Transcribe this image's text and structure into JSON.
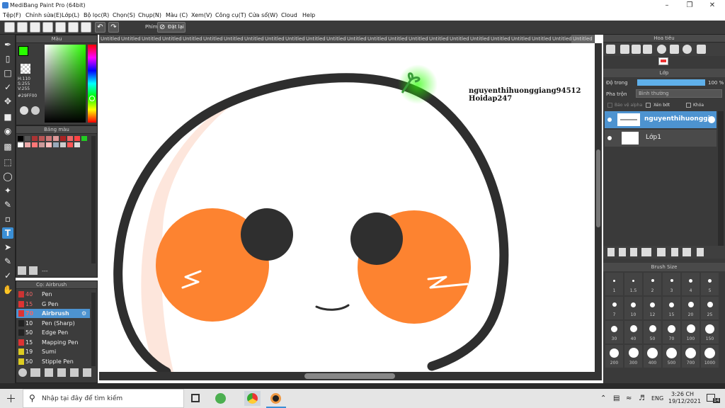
{
  "app": {
    "title": "MediBang Paint Pro (64bit)"
  },
  "menu": [
    "Tệp(F)",
    "Chỉnh sửa(E)",
    "Lớp(L)",
    "Bộ lọc(R)",
    "Chọn(S)",
    "Chụp(N)",
    "Màu (C)",
    "Xem(V)",
    "Công cụ(T)",
    "Cửa sổ(W)",
    "Cloud",
    "Help"
  ],
  "toolbar": {
    "phim_label": "Phím",
    "reset_label": "Đặt lại"
  },
  "color_panel": {
    "title": "Màu",
    "h": "H:110",
    "s": "S:255",
    "v": "V:255",
    "hex": "#29FF00",
    "fg": "#29ff00"
  },
  "palette_panel": {
    "title": "Bảng màu",
    "colors": [
      "#000000",
      "#555555",
      "#aa3333",
      "#bb5555",
      "#cc7777",
      "#dd9999",
      "#aa2222",
      "#ee6666",
      "#ff4444",
      "#22cc22",
      "#ffffff",
      "#eeaaaa",
      "#ff7777",
      "#cc9999",
      "#ffbbbb",
      "#99aabb",
      "#cccccc",
      "#ff5555",
      "#dddddd"
    ],
    "dash": "---"
  },
  "brush_panel": {
    "title": "Cọ: Airbrush",
    "items": [
      {
        "size": "40",
        "name": "Pen",
        "color": "#cc3333",
        "selected": false
      },
      {
        "size": "15",
        "name": "G Pen",
        "color": "#dd3333",
        "selected": false
      },
      {
        "size": "70",
        "name": "Airbrush",
        "color": "#dd3333",
        "selected": true
      },
      {
        "size": "10",
        "name": "Pen (Sharp)",
        "color": "#222222",
        "selected": false
      },
      {
        "size": "50",
        "name": "Edge Pen",
        "color": "#222222",
        "selected": false
      },
      {
        "size": "15",
        "name": "Mapping Pen",
        "color": "#dd3333",
        "selected": false
      },
      {
        "size": "19",
        "name": "Sumi",
        "color": "#ddcc22",
        "selected": false
      },
      {
        "size": "50",
        "name": "Stipple Pen",
        "color": "#ddcc22",
        "selected": false
      }
    ]
  },
  "tabs": [
    "Untitled",
    "Untitled",
    "Untitled",
    "Untitled",
    "Untitled",
    "Untitled",
    "Untitled",
    "Untitled",
    "Untitled",
    "Untitled",
    "Untitled",
    "Untitled",
    "Untitled",
    "Untitled",
    "Untitled",
    "Untitled",
    "Untitled",
    "Untitled",
    "Untitled",
    "Untitled",
    "Untitled",
    "Untitled",
    "Untitled",
    "Untitled"
  ],
  "canvas": {
    "text_line1": "nguyenthihuonggiang94512",
    "text_line2": "Hoidap247"
  },
  "navigator": {
    "title": "Hoa tiêu"
  },
  "layer_panel": {
    "title": "Lớp",
    "opacity_label": "Độ trong",
    "opacity_value": "100 %",
    "opacity_fraction": 1.0,
    "blend_label": "Pha trộn",
    "blend_value": "Bình thường",
    "protect_alpha": "Bảo vệ alpha",
    "clip": "Xén bớt",
    "lock": "Khóa",
    "layers": [
      {
        "name": "nguyenthihuonggiang",
        "selected": true
      },
      {
        "name": "Lớp1",
        "selected": false
      }
    ]
  },
  "brush_size": {
    "title": "Brush Size",
    "sizes": [
      "1",
      "1.5",
      "2",
      "3",
      "4",
      "5",
      "7",
      "10",
      "12",
      "15",
      "20",
      "25",
      "30",
      "40",
      "50",
      "70",
      "100",
      "150",
      "200",
      "300",
      "400",
      "500",
      "700",
      "1000"
    ]
  },
  "taskbar": {
    "search_placeholder": "Nhập tại đây để tìm kiếm",
    "time": "3:26 CH",
    "date": "19/12/2021",
    "lang": "ENG",
    "notif": "14"
  }
}
